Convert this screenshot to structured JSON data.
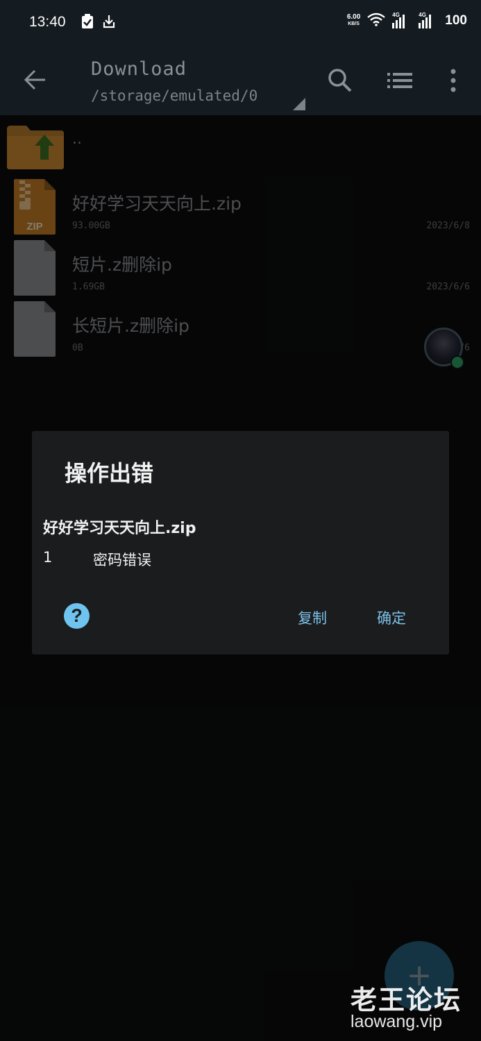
{
  "status_bar": {
    "time": "13:40",
    "net_speed_value": "6.00",
    "net_speed_unit": "KB/S",
    "signal1_label": "4G",
    "signal2_label": "4G",
    "battery": "100"
  },
  "toolbar": {
    "title": "Download",
    "path": "/storage/emulated/0"
  },
  "file_list": {
    "parent_label": "..",
    "files": [
      {
        "name": "好好学习天天向上.zip",
        "size": "93.00GB",
        "date": "2023/6/8",
        "icon": "zip-file-icon",
        "icon_label": "ZIP"
      },
      {
        "name": "短片.z删除ip",
        "size": "1.69GB",
        "date": "2023/6/6",
        "icon": "file-icon"
      },
      {
        "name": "长短片.z删除ip",
        "size": "0B",
        "date": "2023/6/6",
        "icon": "file-icon"
      }
    ]
  },
  "dialog": {
    "title": "操作出错",
    "file_name": "好好学习天天向上.zip",
    "error_code": "1",
    "error_message": "密码错误",
    "copy_label": "复制",
    "ok_label": "确定"
  },
  "fab": {
    "label": "+"
  },
  "watermark": {
    "name": "老王论坛",
    "url": "laowang.vip"
  },
  "colors": {
    "background": "#0b0c0d",
    "toolbar": "#141b21",
    "dialog": "#1b1c1e",
    "accent": "#7cc1e8",
    "zip_icon": "#d48a2a"
  }
}
